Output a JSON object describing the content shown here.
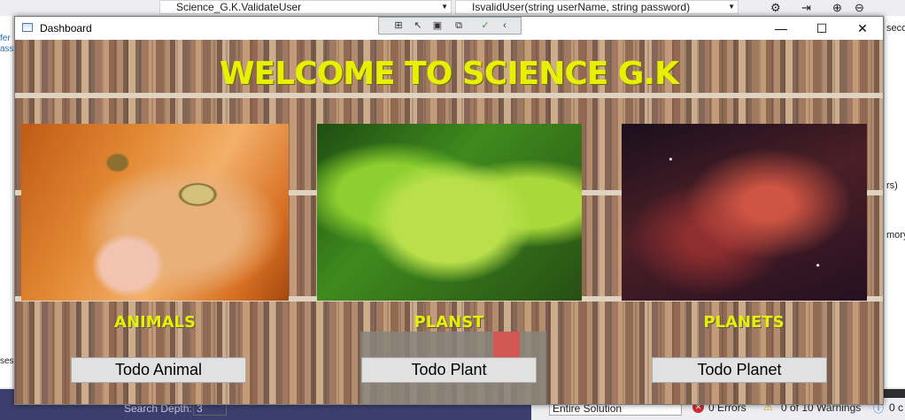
{
  "vs": {
    "combo_left": "Science_G.K.ValidateUser",
    "combo_right": "IsvalidUser(string userName, string password)",
    "side_text_1": "seco",
    "side_text_2": "rs)",
    "side_text_3": "mory",
    "left_text_1": "fer",
    "left_text_2": "ass",
    "left_text_3": "ses",
    "search_depth_label": "Search Depth:",
    "search_depth_value": "3",
    "scope": "Entire Solution",
    "errors": "0 Errors",
    "warnings": "0 of 10 Warnings",
    "messages": "0 c"
  },
  "window": {
    "title": "Dashboard",
    "minimize": "—",
    "maximize": "☐",
    "close": "✕"
  },
  "app": {
    "heading": "WELCOME TO SCIENCE G.K",
    "categories": [
      {
        "label": "ANIMALS",
        "button": "Todo Animal"
      },
      {
        "label": "PLANST",
        "button": "Todo Plant"
      },
      {
        "label": "PLANETS",
        "button": "Todo Planet"
      }
    ]
  },
  "colors": {
    "heading": "#e6f000",
    "button_bg": "#e1e1e1"
  }
}
